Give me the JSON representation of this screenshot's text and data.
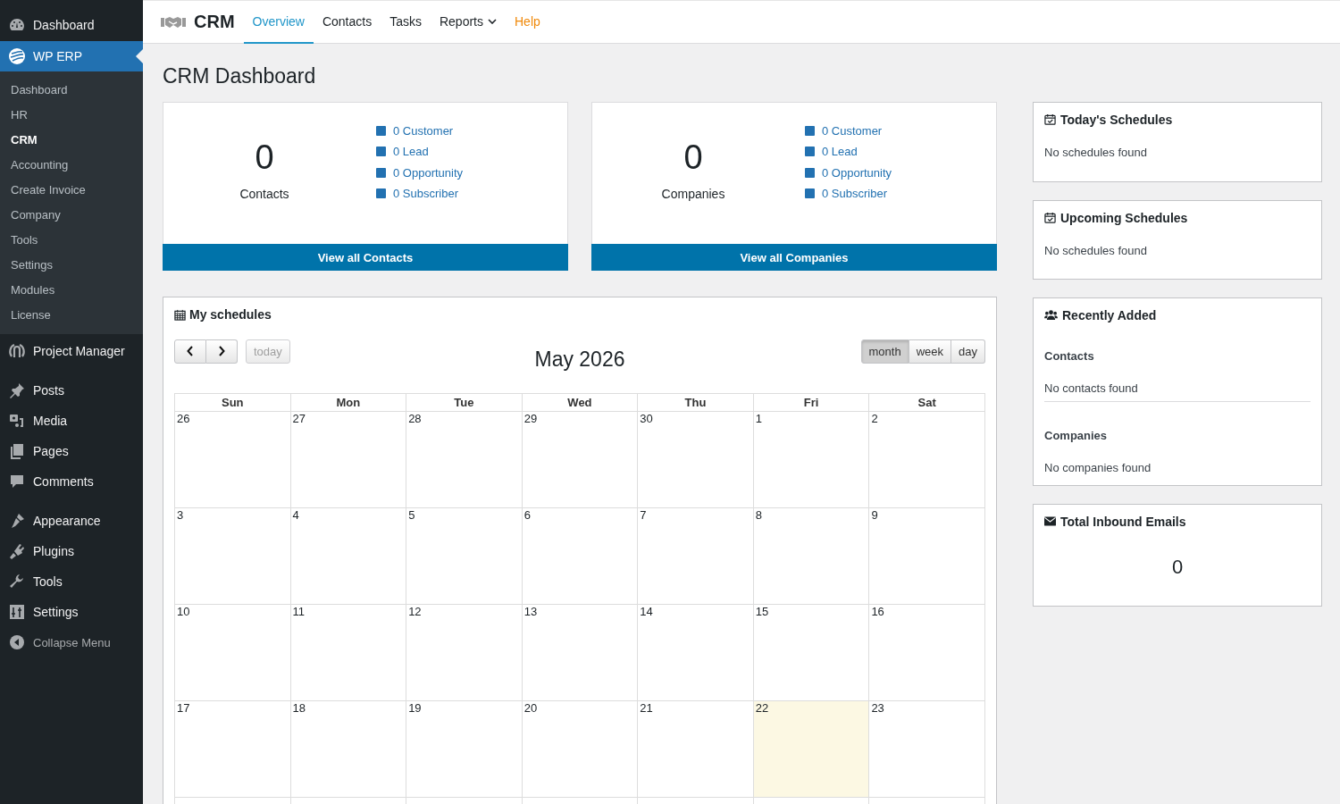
{
  "admin_menu": {
    "top": [
      {
        "label": "Dashboard",
        "selected": false
      },
      {
        "label": "WP ERP",
        "selected": true
      }
    ],
    "submenu": [
      {
        "label": "Dashboard",
        "selected": false
      },
      {
        "label": "HR",
        "selected": false
      },
      {
        "label": "CRM",
        "selected": true
      },
      {
        "label": "Accounting",
        "selected": false
      },
      {
        "label": "Create Invoice",
        "selected": false
      },
      {
        "label": "Company",
        "selected": false
      },
      {
        "label": "Tools",
        "selected": false
      },
      {
        "label": "Settings",
        "selected": false
      },
      {
        "label": "Modules",
        "selected": false
      },
      {
        "label": "License",
        "selected": false
      }
    ],
    "groups": [
      [
        {
          "label": "Project Manager",
          "selected": false
        }
      ],
      [
        {
          "label": "Posts",
          "selected": false
        },
        {
          "label": "Media",
          "selected": false
        },
        {
          "label": "Pages",
          "selected": false
        },
        {
          "label": "Comments",
          "selected": false
        }
      ],
      [
        {
          "label": "Appearance",
          "selected": false
        },
        {
          "label": "Plugins",
          "selected": false
        },
        {
          "label": "Tools",
          "selected": false
        },
        {
          "label": "Settings",
          "selected": false
        }
      ]
    ],
    "collapse": "Collapse Menu"
  },
  "topnav": {
    "brand": "CRM",
    "tabs": [
      {
        "label": "Overview",
        "selected": true,
        "has_menu": false,
        "kind": "tab"
      },
      {
        "label": "Contacts",
        "selected": false,
        "has_menu": false,
        "kind": "tab"
      },
      {
        "label": "Tasks",
        "selected": false,
        "has_menu": false,
        "kind": "tab"
      },
      {
        "label": "Reports",
        "selected": false,
        "has_menu": true,
        "kind": "tab"
      },
      {
        "label": "Help",
        "selected": false,
        "has_menu": false,
        "kind": "help"
      }
    ]
  },
  "page_title": "CRM Dashboard",
  "stat_cards": [
    {
      "count": "0",
      "label": "Contacts",
      "breakdown": [
        "0 Customer",
        "0 Lead",
        "0 Opportunity",
        "0 Subscriber"
      ],
      "button": "View all Contacts"
    },
    {
      "count": "0",
      "label": "Companies",
      "breakdown": [
        "0 Customer",
        "0 Lead",
        "0 Opportunity",
        "0 Subscriber"
      ],
      "button": "View all Companies"
    }
  ],
  "calendar": {
    "title": "My schedules",
    "today_button": "today",
    "month_label": "May 2026",
    "views": [
      {
        "label": "month",
        "selected": true
      },
      {
        "label": "week",
        "selected": false
      },
      {
        "label": "day",
        "selected": false
      }
    ],
    "weekdays": [
      "Sun",
      "Mon",
      "Tue",
      "Wed",
      "Thu",
      "Fri",
      "Sat"
    ],
    "weeks": [
      [
        {
          "day": "26",
          "today": false
        },
        {
          "day": "27",
          "today": false
        },
        {
          "day": "28",
          "today": false
        },
        {
          "day": "29",
          "today": false
        },
        {
          "day": "30",
          "today": false
        },
        {
          "day": "1",
          "today": false
        },
        {
          "day": "2",
          "today": false
        }
      ],
      [
        {
          "day": "3",
          "today": false
        },
        {
          "day": "4",
          "today": false
        },
        {
          "day": "5",
          "today": false
        },
        {
          "day": "6",
          "today": false
        },
        {
          "day": "7",
          "today": false
        },
        {
          "day": "8",
          "today": false
        },
        {
          "day": "9",
          "today": false
        }
      ],
      [
        {
          "day": "10",
          "today": false
        },
        {
          "day": "11",
          "today": false
        },
        {
          "day": "12",
          "today": false
        },
        {
          "day": "13",
          "today": false
        },
        {
          "day": "14",
          "today": false
        },
        {
          "day": "15",
          "today": false
        },
        {
          "day": "16",
          "today": false
        }
      ],
      [
        {
          "day": "17",
          "today": false
        },
        {
          "day": "18",
          "today": false
        },
        {
          "day": "19",
          "today": false
        },
        {
          "day": "20",
          "today": false
        },
        {
          "day": "21",
          "today": false
        },
        {
          "day": "22",
          "today": true
        },
        {
          "day": "23",
          "today": false
        }
      ]
    ]
  },
  "todays_schedules": {
    "title": "Today's Schedules",
    "empty": "No schedules found"
  },
  "upcoming_schedules": {
    "title": "Upcoming Schedules",
    "empty": "No schedules found"
  },
  "recently_added": {
    "title": "Recently Added",
    "sections": [
      {
        "heading": "Contacts",
        "empty": "No contacts found"
      },
      {
        "heading": "Companies",
        "empty": "No companies found"
      }
    ]
  },
  "inbound_emails": {
    "title": "Total Inbound Emails",
    "count": "0"
  }
}
